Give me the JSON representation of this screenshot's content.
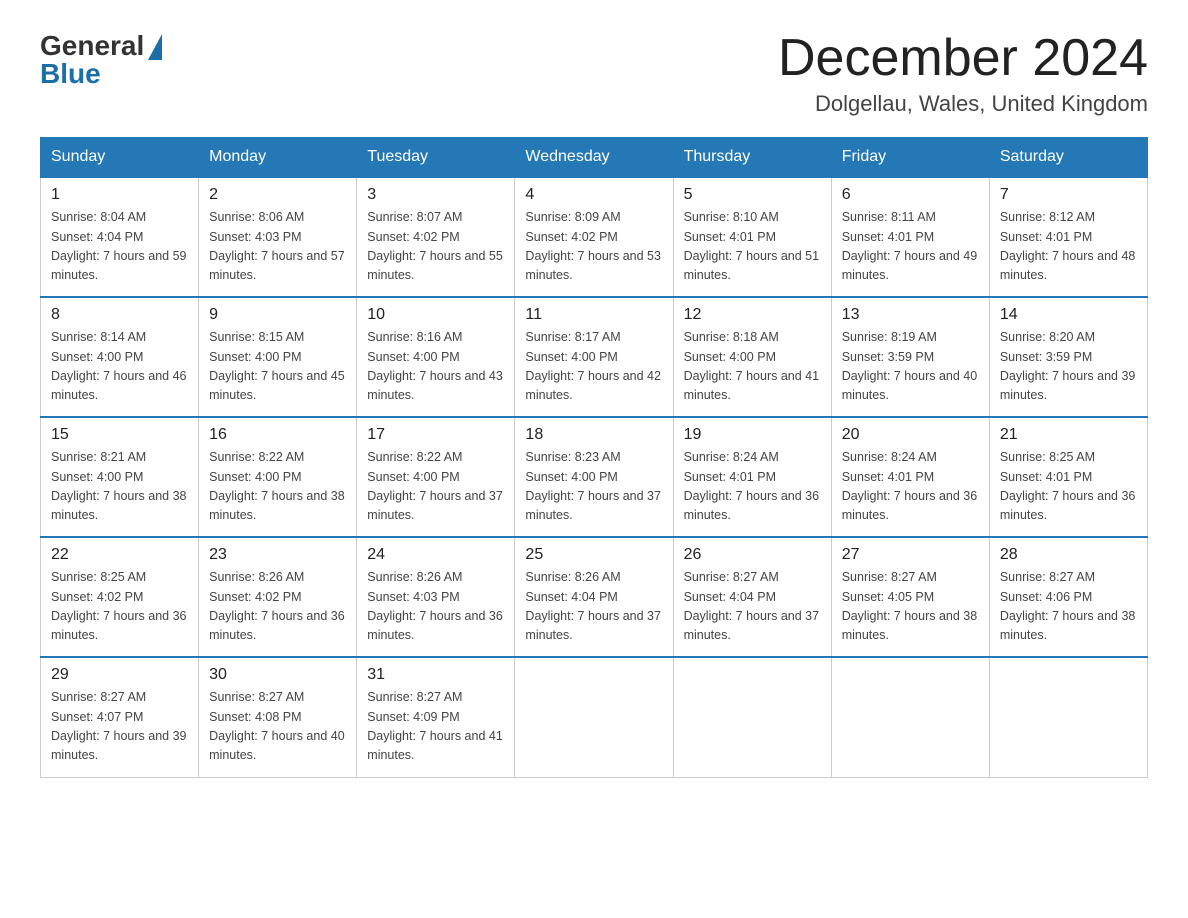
{
  "logo": {
    "general": "General",
    "blue": "Blue"
  },
  "title": "December 2024",
  "location": "Dolgellau, Wales, United Kingdom",
  "days_of_week": [
    "Sunday",
    "Monday",
    "Tuesday",
    "Wednesday",
    "Thursday",
    "Friday",
    "Saturday"
  ],
  "weeks": [
    [
      {
        "day": "1",
        "sunrise": "8:04 AM",
        "sunset": "4:04 PM",
        "daylight": "7 hours and 59 minutes."
      },
      {
        "day": "2",
        "sunrise": "8:06 AM",
        "sunset": "4:03 PM",
        "daylight": "7 hours and 57 minutes."
      },
      {
        "day": "3",
        "sunrise": "8:07 AM",
        "sunset": "4:02 PM",
        "daylight": "7 hours and 55 minutes."
      },
      {
        "day": "4",
        "sunrise": "8:09 AM",
        "sunset": "4:02 PM",
        "daylight": "7 hours and 53 minutes."
      },
      {
        "day": "5",
        "sunrise": "8:10 AM",
        "sunset": "4:01 PM",
        "daylight": "7 hours and 51 minutes."
      },
      {
        "day": "6",
        "sunrise": "8:11 AM",
        "sunset": "4:01 PM",
        "daylight": "7 hours and 49 minutes."
      },
      {
        "day": "7",
        "sunrise": "8:12 AM",
        "sunset": "4:01 PM",
        "daylight": "7 hours and 48 minutes."
      }
    ],
    [
      {
        "day": "8",
        "sunrise": "8:14 AM",
        "sunset": "4:00 PM",
        "daylight": "7 hours and 46 minutes."
      },
      {
        "day": "9",
        "sunrise": "8:15 AM",
        "sunset": "4:00 PM",
        "daylight": "7 hours and 45 minutes."
      },
      {
        "day": "10",
        "sunrise": "8:16 AM",
        "sunset": "4:00 PM",
        "daylight": "7 hours and 43 minutes."
      },
      {
        "day": "11",
        "sunrise": "8:17 AM",
        "sunset": "4:00 PM",
        "daylight": "7 hours and 42 minutes."
      },
      {
        "day": "12",
        "sunrise": "8:18 AM",
        "sunset": "4:00 PM",
        "daylight": "7 hours and 41 minutes."
      },
      {
        "day": "13",
        "sunrise": "8:19 AM",
        "sunset": "3:59 PM",
        "daylight": "7 hours and 40 minutes."
      },
      {
        "day": "14",
        "sunrise": "8:20 AM",
        "sunset": "3:59 PM",
        "daylight": "7 hours and 39 minutes."
      }
    ],
    [
      {
        "day": "15",
        "sunrise": "8:21 AM",
        "sunset": "4:00 PM",
        "daylight": "7 hours and 38 minutes."
      },
      {
        "day": "16",
        "sunrise": "8:22 AM",
        "sunset": "4:00 PM",
        "daylight": "7 hours and 38 minutes."
      },
      {
        "day": "17",
        "sunrise": "8:22 AM",
        "sunset": "4:00 PM",
        "daylight": "7 hours and 37 minutes."
      },
      {
        "day": "18",
        "sunrise": "8:23 AM",
        "sunset": "4:00 PM",
        "daylight": "7 hours and 37 minutes."
      },
      {
        "day": "19",
        "sunrise": "8:24 AM",
        "sunset": "4:01 PM",
        "daylight": "7 hours and 36 minutes."
      },
      {
        "day": "20",
        "sunrise": "8:24 AM",
        "sunset": "4:01 PM",
        "daylight": "7 hours and 36 minutes."
      },
      {
        "day": "21",
        "sunrise": "8:25 AM",
        "sunset": "4:01 PM",
        "daylight": "7 hours and 36 minutes."
      }
    ],
    [
      {
        "day": "22",
        "sunrise": "8:25 AM",
        "sunset": "4:02 PM",
        "daylight": "7 hours and 36 minutes."
      },
      {
        "day": "23",
        "sunrise": "8:26 AM",
        "sunset": "4:02 PM",
        "daylight": "7 hours and 36 minutes."
      },
      {
        "day": "24",
        "sunrise": "8:26 AM",
        "sunset": "4:03 PM",
        "daylight": "7 hours and 36 minutes."
      },
      {
        "day": "25",
        "sunrise": "8:26 AM",
        "sunset": "4:04 PM",
        "daylight": "7 hours and 37 minutes."
      },
      {
        "day": "26",
        "sunrise": "8:27 AM",
        "sunset": "4:04 PM",
        "daylight": "7 hours and 37 minutes."
      },
      {
        "day": "27",
        "sunrise": "8:27 AM",
        "sunset": "4:05 PM",
        "daylight": "7 hours and 38 minutes."
      },
      {
        "day": "28",
        "sunrise": "8:27 AM",
        "sunset": "4:06 PM",
        "daylight": "7 hours and 38 minutes."
      }
    ],
    [
      {
        "day": "29",
        "sunrise": "8:27 AM",
        "sunset": "4:07 PM",
        "daylight": "7 hours and 39 minutes."
      },
      {
        "day": "30",
        "sunrise": "8:27 AM",
        "sunset": "4:08 PM",
        "daylight": "7 hours and 40 minutes."
      },
      {
        "day": "31",
        "sunrise": "8:27 AM",
        "sunset": "4:09 PM",
        "daylight": "7 hours and 41 minutes."
      },
      null,
      null,
      null,
      null
    ]
  ]
}
